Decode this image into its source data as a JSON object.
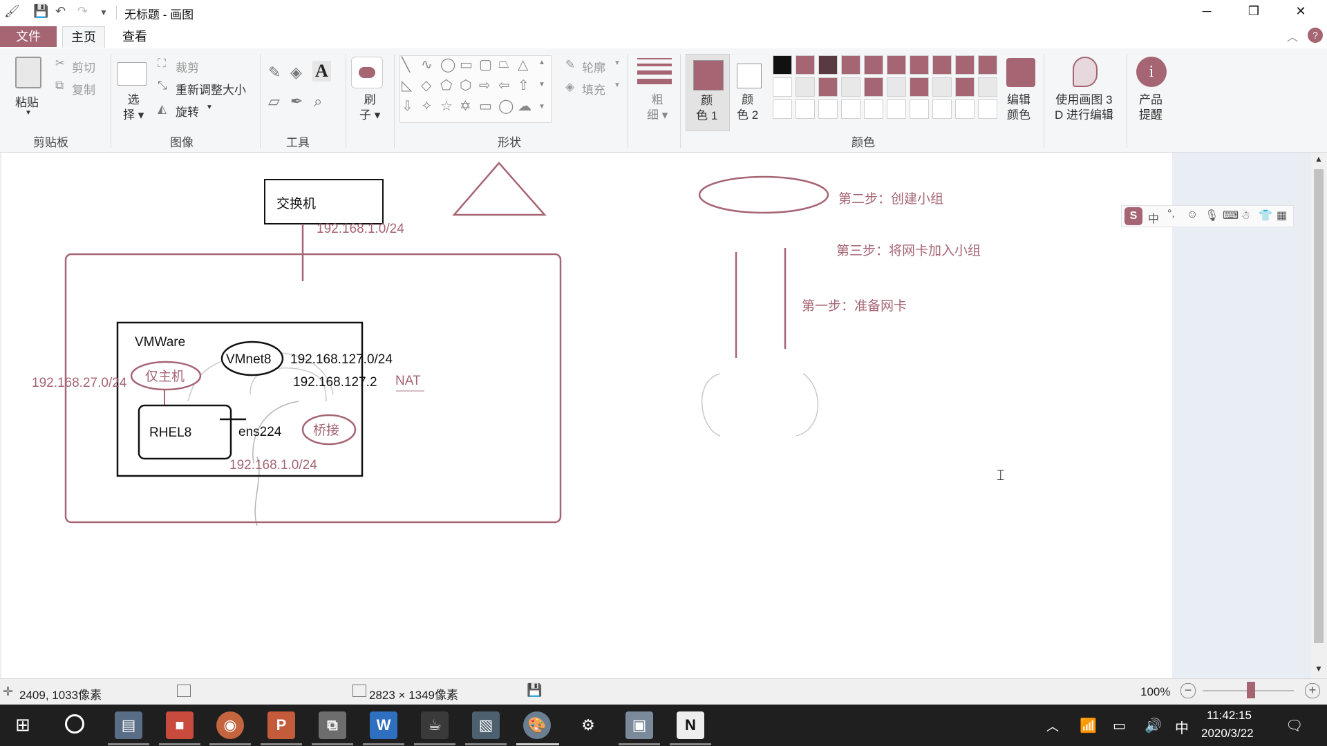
{
  "window": {
    "title": "无标题 - 画图",
    "minimize": "─",
    "restore": "❐",
    "close": "✕"
  },
  "tabs": {
    "file": "文件",
    "home": "主页",
    "view": "查看"
  },
  "ribbon": {
    "clipboard": {
      "paste": "粘贴",
      "cut": "剪切",
      "copy": "复制",
      "label": "剪贴板"
    },
    "image": {
      "select_line1": "选",
      "select_line2": "择",
      "crop": "裁剪",
      "resize": "重新调整大小",
      "rotate": "旋转",
      "label": "图像"
    },
    "tools": {
      "label": "工具"
    },
    "brush": {
      "line1": "刷",
      "line2": "子"
    },
    "shapes": {
      "outline": "轮廓",
      "fill": "填充",
      "label": "形状"
    },
    "size": {
      "line1": "粗",
      "line2": "细"
    },
    "color1": {
      "line1": "颜",
      "line2": "色 1"
    },
    "color2": {
      "line1": "颜",
      "line2": "色 2"
    },
    "colors": {
      "label": "颜色",
      "edit_line1": "编辑",
      "edit_line2": "颜色"
    },
    "paint3d": {
      "line1": "使用画图 3",
      "line2": "D 进行编辑"
    },
    "product": {
      "line1": "产品",
      "line2": "提醒"
    },
    "palette_row1": [
      "#111111",
      "#a56573",
      "#5a3a42",
      "#a56573",
      "#a56573",
      "#a56573",
      "#a56573",
      "#a56573",
      "#a56573",
      "#a56573"
    ],
    "palette_row2": [
      "#ffffff",
      "#e8e8e8",
      "#a56573",
      "#e8e8e8",
      "#a56573",
      "#e8e8e8",
      "#a56573",
      "#e8e8e8",
      "#a56573",
      "#e8e8e8"
    ],
    "color1_value": "#a56573",
    "color2_value": "#ffffff"
  },
  "canvas": {
    "switch_label": "交换机",
    "switch_net": "192.168.1.0/24",
    "vmware": "VMWare",
    "vmnet8": "VMnet8",
    "vmnet8_net": "192.168.127.0/24",
    "vmnet8_gw": "192.168.127.2",
    "nat": "NAT",
    "host_only": "仅主机",
    "host_only_net": "192.168.27.0/24",
    "rhel8": "RHEL8",
    "ens224": "ens224",
    "bridge": "桥接",
    "bridge_net": "192.168.1.0/24",
    "step2": "第二步：创建小组",
    "step3": "第三步：将网卡加入小组",
    "step1": "第一步：准备网卡"
  },
  "ime": {
    "mode": "中",
    "punct": "°,"
  },
  "status": {
    "cursor_pos": "2409, 1033像素",
    "image_size": "2823 × 1349像素",
    "zoom": "100%"
  },
  "taskbar": {
    "time": "11:42:15",
    "date": "2020/3/22",
    "ime_lang": "中"
  }
}
